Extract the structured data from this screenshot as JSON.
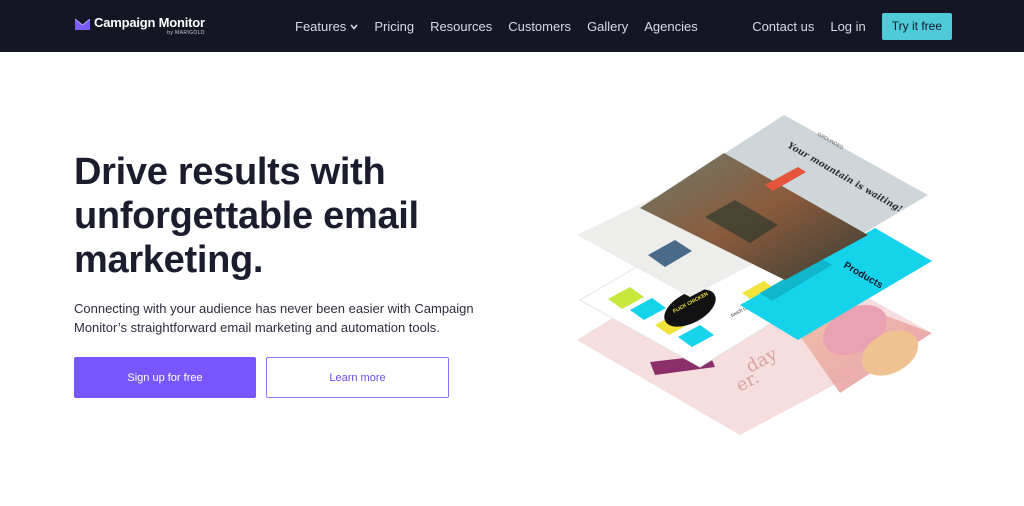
{
  "nav": {
    "logo_name": "Campaign Monitor",
    "logo_sub": "by MARIGOLD",
    "links": [
      "Features",
      "Pricing",
      "Resources",
      "Customers",
      "Gallery",
      "Agencies"
    ],
    "contact": "Contact us",
    "login": "Log in",
    "cta": "Try it free"
  },
  "hero": {
    "headline_1": "Drive results with",
    "headline_2": "unforgettable email",
    "headline_3": "marketing.",
    "subtext": "Connecting with your audience has never been easier with Campaign Monitor’s straightforward email marketing and automation tools.",
    "primary_cta": "Sign up for free",
    "secondary_cta": "Learn more"
  },
  "illustration": {
    "card1_headline": "Your mountain is waiting!",
    "card1_brand": "GROUNDED",
    "card2_title": "Products",
    "card3_label": "touch range",
    "card3_badge": "FLICK CHICKEN",
    "card4_text": "day",
    "card4_text2": "er.",
    "accent_colors": {
      "brand_purple": "#7856ff",
      "nav_bg": "#141624",
      "cta_teal": "#4ecad8",
      "card_cyan": "#16d3ec",
      "card_pink": "#f6dede",
      "card_orange": "#e5543c"
    }
  }
}
